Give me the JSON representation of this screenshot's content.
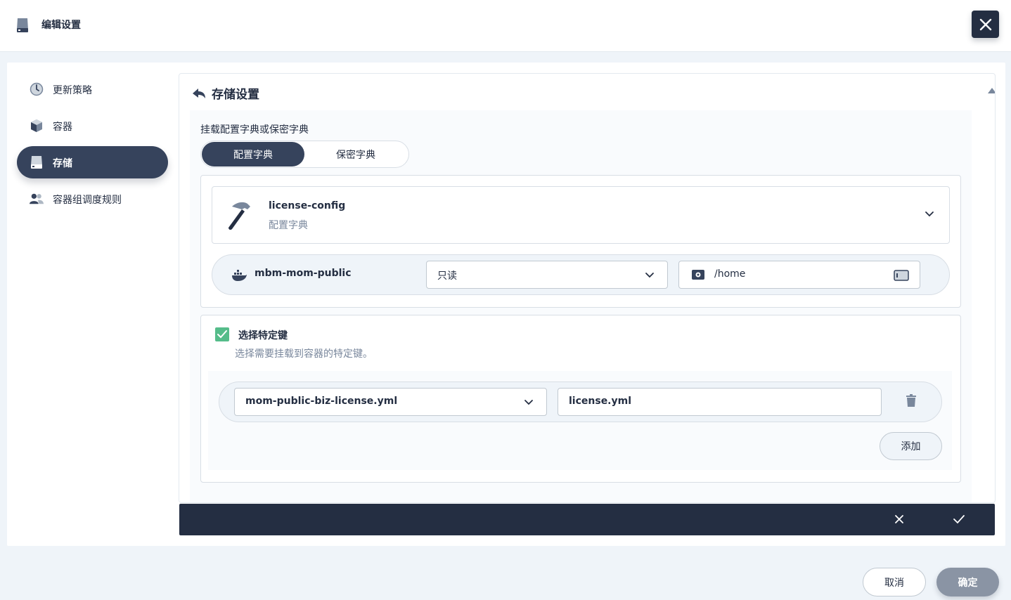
{
  "header": {
    "title": "编辑设置",
    "icon": "storage-icon",
    "close_icon": "close-icon"
  },
  "sidebar": {
    "items": [
      {
        "label": "更新策略",
        "icon": "update-strategy-icon",
        "active": false
      },
      {
        "label": "容器",
        "icon": "container-icon",
        "active": false
      },
      {
        "label": "存储",
        "icon": "storage-icon",
        "active": true
      },
      {
        "label": "容器组调度规则",
        "icon": "users-icon",
        "active": false
      }
    ]
  },
  "panel": {
    "title": "存储设置",
    "back_icon": "back-arrow-icon",
    "mount_label": "挂载配置字典或保密字典",
    "segment": {
      "options": [
        "配置字典",
        "保密字典"
      ],
      "selected": "配置字典"
    },
    "config": {
      "name": "license-config",
      "type": "配置字典",
      "icon": "hammer-icon"
    },
    "container": {
      "name": "mbm-mom-public",
      "icon": "docker-icon",
      "access_mode": "只读",
      "mount_path": "/home",
      "mount_path_icon": "gear-icon",
      "mount_path_action_icon": "terminal-icon"
    },
    "specific_keys": {
      "checked": true,
      "label": "选择特定键",
      "description": "选择需要挂载到容器的特定键。",
      "rows": [
        {
          "key": "mom-public-biz-license.yml",
          "path": "license.yml"
        }
      ],
      "add_label": "添加"
    }
  },
  "footer": {
    "cancel_label": "取消",
    "ok_label": "确定"
  },
  "colors": {
    "primary_dark": "#242e42",
    "active_nav": "#36435c",
    "check_green": "#55bc8a",
    "muted_text": "#79879c",
    "border": "#d8dee5",
    "bg": "#eff4f9"
  }
}
